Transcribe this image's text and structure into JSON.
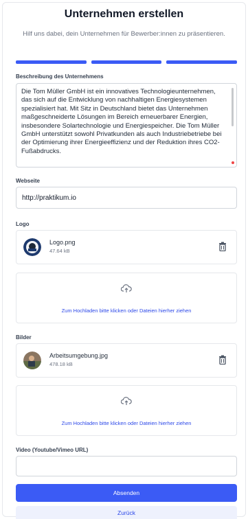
{
  "header": {
    "title": "Unternehmen erstellen",
    "subtitle": "Hilf uns dabei, dein Unternehmen für Bewerber:innen zu präsentieren."
  },
  "steps": {
    "total": 3,
    "completed": 3,
    "color": "#3b5bf5"
  },
  "description": {
    "label": "Beschreibung des Unternehmens",
    "value": "Die Tom Müller GmbH ist ein innovatives Technologieunternehmen, das sich auf die Entwicklung von nachhaltigen Energiesystemen spezialisiert hat. Mit Sitz in Deutschland bietet das Unternehmen maßgeschneiderte Lösungen im Bereich erneuerbarer Energien, insbesondere Solartechnologie und Energiespeicher. Die Tom Müller GmbH unterstützt sowohl Privatkunden als auch Industriebetriebe bei der Optimierung ihrer Energieeffizienz und der Reduktion ihres CO2-Fußabdrucks."
  },
  "website": {
    "label": "Webseite",
    "value": "http://praktikum.io"
  },
  "logo": {
    "label": "Logo",
    "file": {
      "name": "Logo.png",
      "size": "47.64 kB",
      "icon": "trash-icon"
    },
    "upload_text": "Zum Hochladen bitte klicken oder Dateien hierher ziehen"
  },
  "images": {
    "label": "Bilder",
    "file": {
      "name": "Arbeitsumgebung.jpg",
      "size": "478.18 kB",
      "icon": "trash-icon"
    },
    "upload_text": "Zum Hochladen bitte klicken oder Dateien hierher ziehen"
  },
  "video": {
    "label": "Video (Youtube/Vimeo URL)",
    "value": ""
  },
  "actions": {
    "submit": "Absenden",
    "back": "Zurück"
  },
  "colors": {
    "accent": "#3b5bf5",
    "accent_text": "#2b47e8",
    "secondary_bg": "#eef1fd"
  }
}
